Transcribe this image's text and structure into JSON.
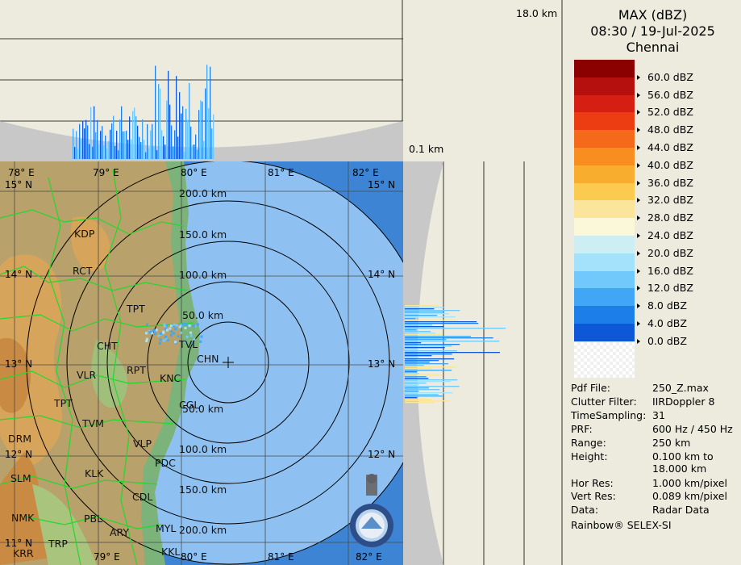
{
  "header": {
    "title": "MAX (dBZ)",
    "datetime": "08:30 / 19-Jul-2025",
    "station": "Chennai"
  },
  "profiles": {
    "top_height_label": "18.0 km",
    "bottom_height_label": "0.1 km"
  },
  "legend": {
    "items": [
      {
        "label": "60.0 dBZ",
        "color": "#8b0000"
      },
      {
        "label": "56.0 dBZ",
        "color": "#b5100d"
      },
      {
        "label": "52.0 dBZ",
        "color": "#d41f12"
      },
      {
        "label": "48.0 dBZ",
        "color": "#ec3d12"
      },
      {
        "label": "44.0 dBZ",
        "color": "#f46a1a"
      },
      {
        "label": "40.0 dBZ",
        "color": "#f88e1f"
      },
      {
        "label": "36.0 dBZ",
        "color": "#f9ad2f"
      },
      {
        "label": "32.0 dBZ",
        "color": "#fbcb4f"
      },
      {
        "label": "28.0 dBZ",
        "color": "#fbe59a"
      },
      {
        "label": "24.0 dBZ",
        "color": "#fbf7d9"
      },
      {
        "label": "20.0 dBZ",
        "color": "#cdeff3"
      },
      {
        "label": "16.0 dBZ",
        "color": "#a4e2fb"
      },
      {
        "label": "12.0 dBZ",
        "color": "#70c8fb"
      },
      {
        "label": "8.0 dBZ",
        "color": "#41a6f6"
      },
      {
        "label": "4.0 dBZ",
        "color": "#1b7ee9"
      },
      {
        "label": "0.0 dBZ",
        "color": "#0e58d8"
      }
    ]
  },
  "info": {
    "pdf_file_key": "Pdf File:",
    "pdf_file_val": "250_Z.max",
    "clutter_key": "Clutter Filter:",
    "clutter_val": "IIRDoppler 8",
    "time_sampling_key": "TimeSampling:",
    "time_sampling_val": "31",
    "prf_key": "PRF:",
    "prf_val": "600 Hz / 450 Hz",
    "range_key": "Range:",
    "range_val": "250 km",
    "height_key": "Height:",
    "height_val_1": "0.100 km to",
    "height_val_2": "18.000 km",
    "hor_res_key": "Hor Res:",
    "hor_res_val": "1.000 km/pixel",
    "vert_res_key": "Vert Res:",
    "vert_res_val": "0.089 km/pixel",
    "data_key": "Data:",
    "data_val": "Radar Data",
    "software": "Rainbow® SELEX-SI"
  },
  "map": {
    "lon_labels": [
      "78° E",
      "79° E",
      "80° E",
      "81° E",
      "82° E"
    ],
    "lat_labels": [
      "15° N",
      "14° N",
      "13° N",
      "12° N",
      "11° N"
    ],
    "range_rings": [
      "200.0 km",
      "150.0 km",
      "100.0 km",
      "50.0 km",
      "50.0 km",
      "100.0 km",
      "150.0 km",
      "200.0 km"
    ],
    "places": [
      "KDP",
      "RCT",
      "TPT",
      "CHT",
      "TVL",
      "CHN",
      "VLR",
      "RPT",
      "KNC",
      "TPT",
      "CGL",
      "TVM",
      "DRM",
      "VLP",
      "SLM",
      "KLK",
      "PDC",
      "CDL",
      "NMK",
      "PBL",
      "ARY",
      "MYL",
      "TRP",
      "KRR",
      "KKL"
    ],
    "logo_colors": {
      "seal": "#5b6f83",
      "ring": "#2e4e8a"
    }
  }
}
